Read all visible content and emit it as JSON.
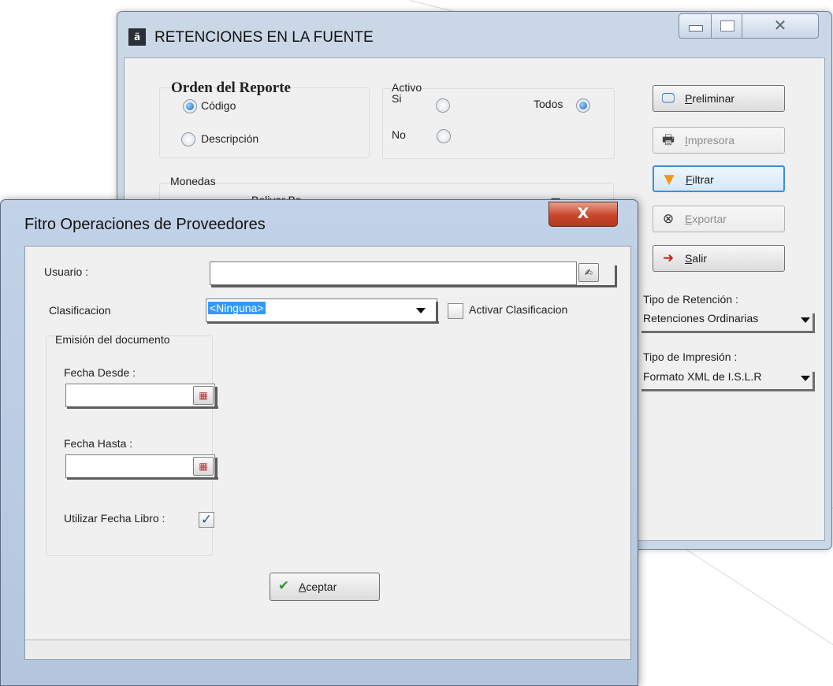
{
  "main_window": {
    "title": "RETENCIONES EN LA FUENTE",
    "icon": "app-logo-icon",
    "caption_buttons": {
      "minimize": "minimize-icon",
      "maximize": "maximize-icon",
      "close_glyph": "✕"
    },
    "orden": {
      "title": "Orden del Reporte",
      "codigo": "Código",
      "descripcion": "Descripción",
      "selected": "Código"
    },
    "activo": {
      "title": "Activo",
      "si": "Si",
      "no": "No",
      "todos": "Todos",
      "selected": "Todos"
    },
    "monedas": {
      "title": "Monedas",
      "value": "Bolivar Bs"
    },
    "buttons": {
      "preliminar": "Preliminar",
      "impresora": "Impresora",
      "filtrar": "Filtrar",
      "exportar": "Exportar",
      "salir": "Salir"
    },
    "tipo_retencion": {
      "label": "Tipo de Retención :",
      "value": "Retenciones Ordinarias"
    },
    "tipo_impresion": {
      "label": "Tipo de Impresión :",
      "value": "Formato XML de I.S.L.R"
    }
  },
  "dialog": {
    "title": "Fitro Operaciones de Proveedores",
    "close_glyph": "X",
    "usuario": {
      "label": "Usuario :",
      "value": "",
      "button_glyph": "✍"
    },
    "clasificacion": {
      "label": "Clasificacion",
      "value": "<Ninguna>",
      "checkbox_label": "Activar Clasificacion",
      "checkbox_checked": false
    },
    "emision": {
      "title": "Emisión del documento",
      "fecha_desde": {
        "label": "Fecha Desde :",
        "value": ""
      },
      "fecha_hasta": {
        "label": "Fecha Hasta :",
        "value": ""
      },
      "calendar_glyph": "▦",
      "utilizar_label": "Utilizar Fecha Libro :",
      "utilizar_checked": true,
      "check_glyph": "✓"
    },
    "aceptar": "Aceptar"
  },
  "colors": {
    "window_frame": "#c9d7e6",
    "client_bg": "#f0f0f0",
    "focus_border": "#3c90d6",
    "selection": "#3399ff",
    "close_red": "#c9462b"
  }
}
